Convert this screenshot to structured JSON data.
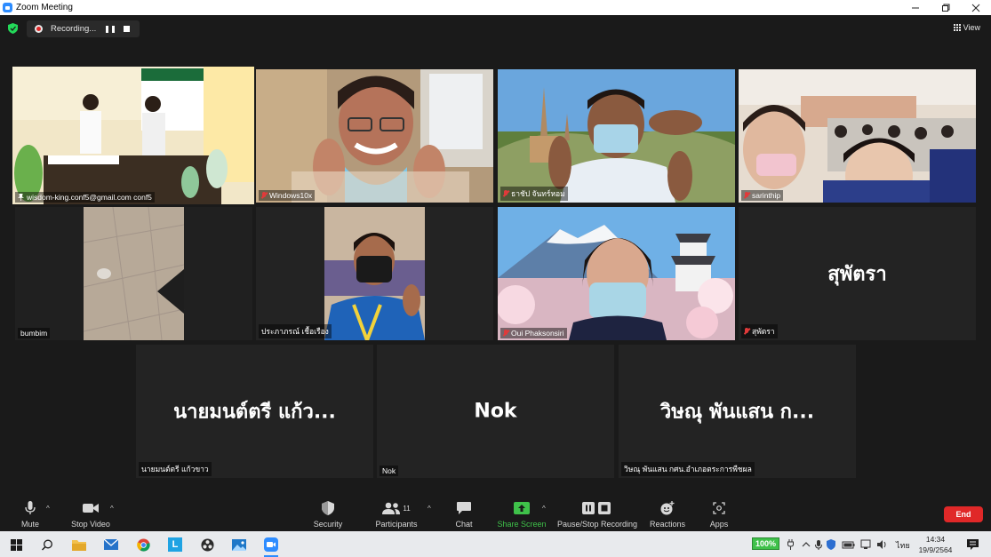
{
  "window": {
    "title": "Zoom Meeting",
    "controls": [
      "minimize",
      "restore",
      "close"
    ]
  },
  "topbar": {
    "recording_label": "Recording...",
    "view_label": "View"
  },
  "participants": [
    {
      "name": "wisdom-king.conf5@gmail.com conf5",
      "video": true,
      "muted": false,
      "pinned": true,
      "active_speaker": true
    },
    {
      "name": "Windows10x",
      "video": true,
      "muted": true
    },
    {
      "name": "ธาชัป  จันทร์หอม",
      "video": true,
      "muted": true
    },
    {
      "name": "sarinthip",
      "video": true,
      "muted": true
    },
    {
      "name": "bumbim",
      "video": true,
      "muted": false
    },
    {
      "name": "ประภาภรณ์ เชื้อเรือง",
      "video": true,
      "muted": false
    },
    {
      "name": "Oui Phaksonsiri",
      "video": true,
      "muted": true
    },
    {
      "name": "สุพัตรา",
      "display_name": "สุพัตรา",
      "video": false,
      "muted": true
    },
    {
      "name": "นายมนต์ตรี แก้วขาว",
      "display_name": "นายมนต์ตรี แก้ว...",
      "video": false,
      "muted": false
    },
    {
      "name": "Nok",
      "display_name": "Nok",
      "video": false,
      "muted": false
    },
    {
      "name": "วิษณุ พันแสน  กศน.อำเภอตระการพืชผล",
      "display_name": "วิษณุ พันแสน  ก...",
      "video": false,
      "muted": false
    }
  ],
  "toolbar": {
    "mute": "Mute",
    "stop_video": "Stop Video",
    "security": "Security",
    "participants": "Participants",
    "participants_count": "11",
    "chat": "Chat",
    "share_screen": "Share Screen",
    "recording": "Pause/Stop Recording",
    "reactions": "Reactions",
    "apps": "Apps",
    "end": "End"
  },
  "taskbar": {
    "battery": "100%",
    "language": "ไทย",
    "time": "14:34",
    "date": "19/9/2564"
  },
  "colors": {
    "active_speaker": "#d9e83c",
    "share_screen": "#3fc14a",
    "end_button": "#e02828",
    "recording_dot": "#e02828"
  }
}
